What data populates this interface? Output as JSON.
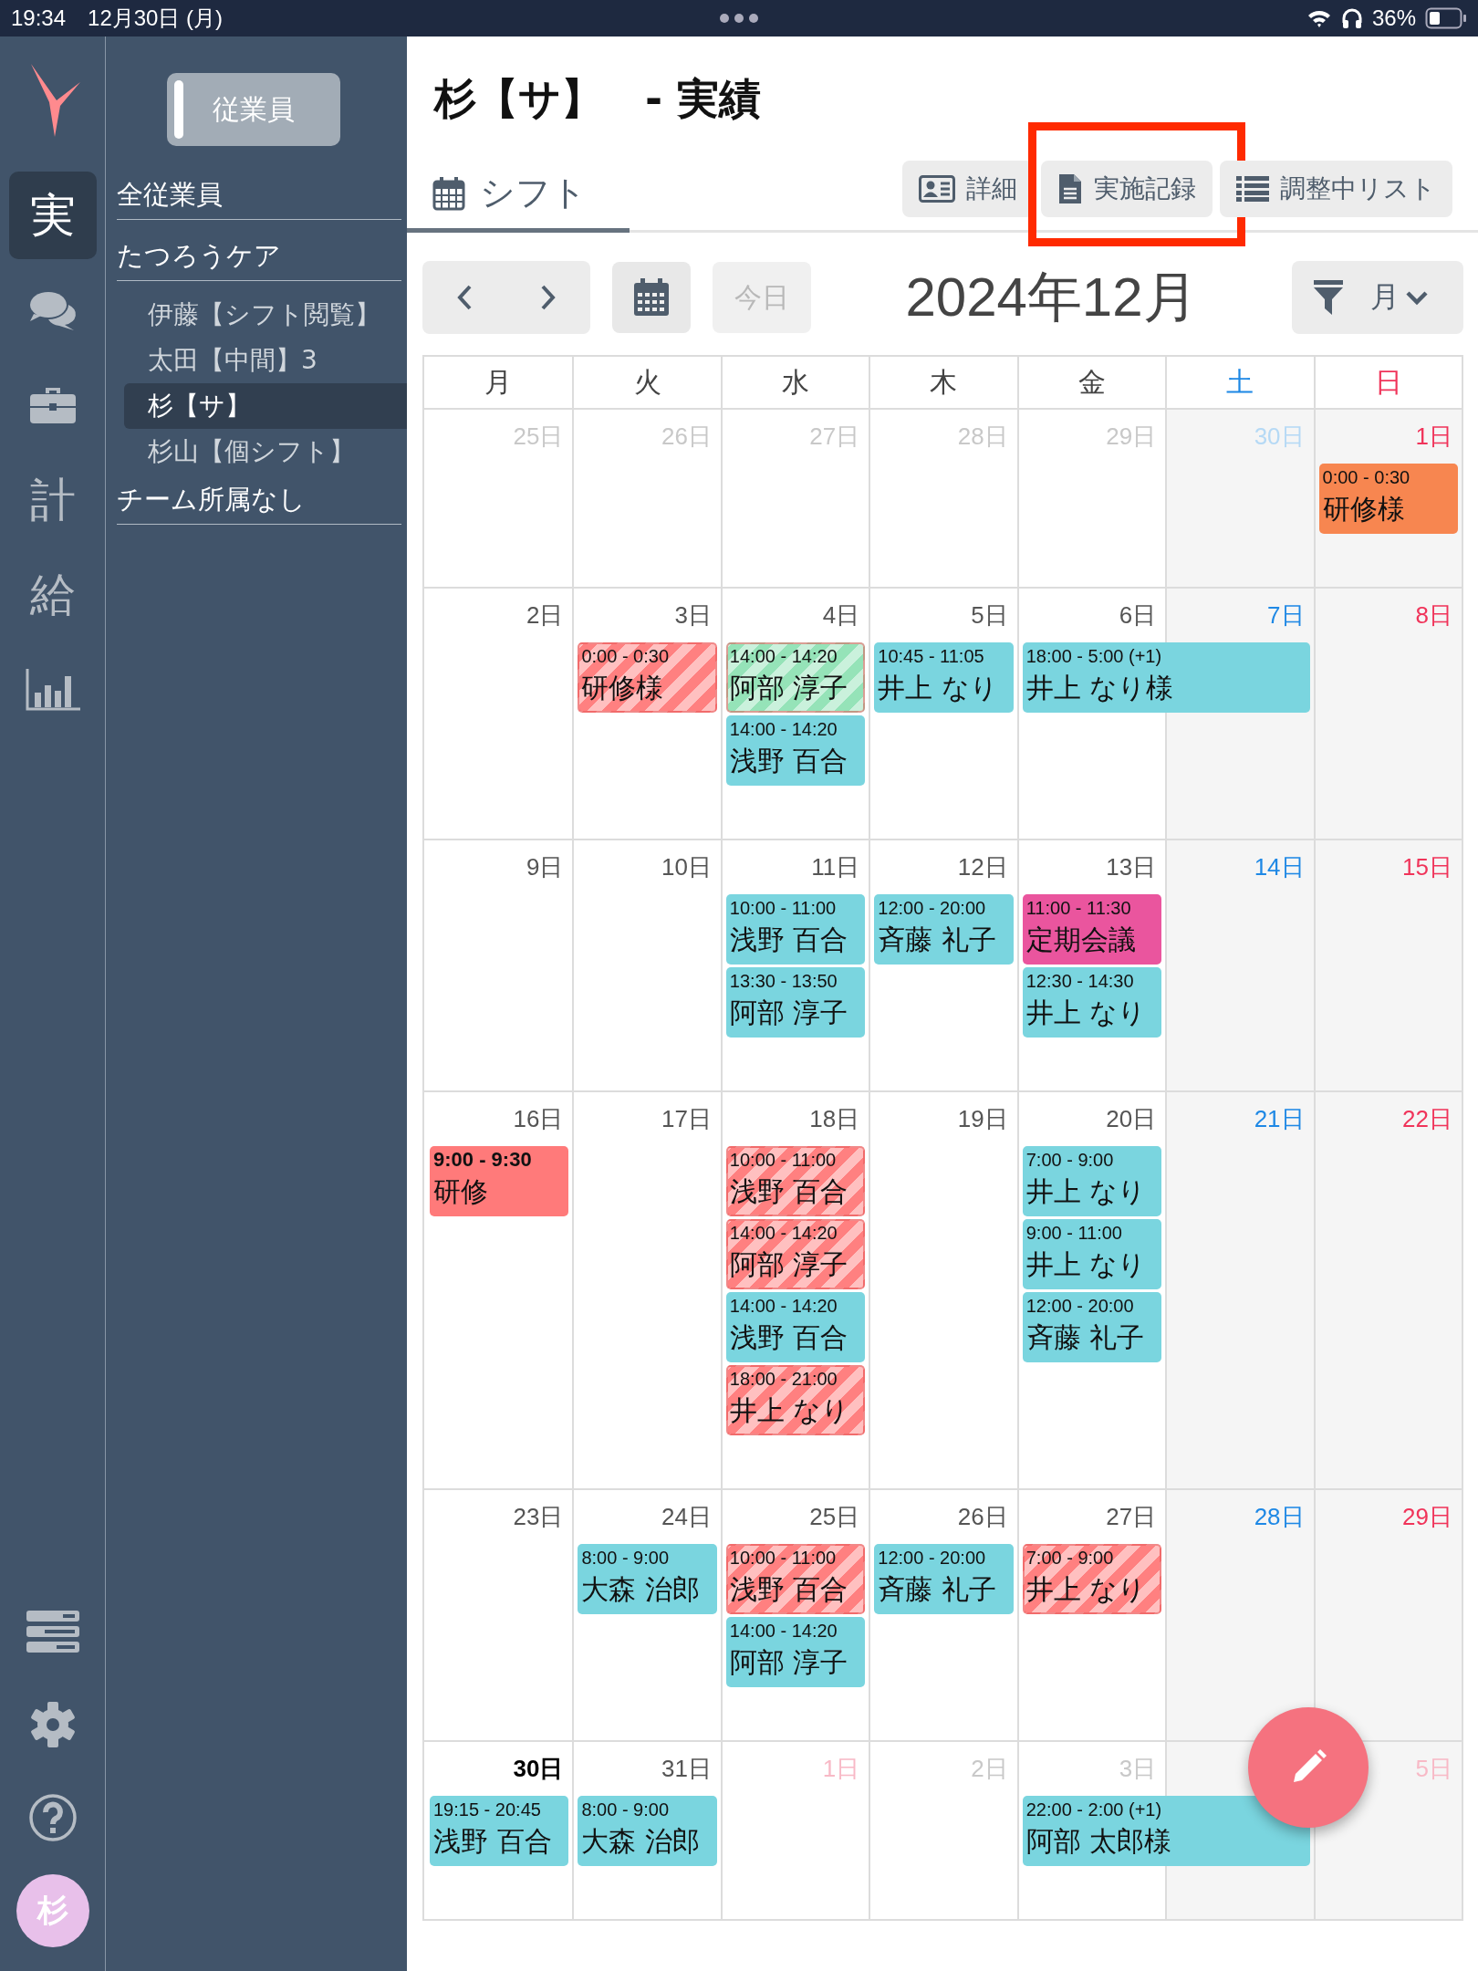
{
  "status_bar": {
    "time": "19:34",
    "date": "12月30日 (月)",
    "battery": "36%"
  },
  "rail": {
    "top": [
      {
        "kind": "text",
        "label": "実",
        "selected": true
      },
      {
        "kind": "chat",
        "selected": false
      },
      {
        "kind": "briefcase",
        "selected": false
      },
      {
        "kind": "text",
        "label": "計",
        "selected": false
      },
      {
        "kind": "text",
        "label": "給",
        "selected": false
      },
      {
        "kind": "chart",
        "selected": false
      }
    ],
    "bottom": [
      {
        "kind": "list"
      },
      {
        "kind": "settings"
      },
      {
        "kind": "help"
      },
      {
        "kind": "avatar",
        "label": "杉"
      }
    ]
  },
  "sidebar": {
    "toggle": "従業員",
    "groups": [
      {
        "title": "全従業員"
      },
      {
        "title": "たつろうケア",
        "items": [
          {
            "label": "伊藤【シフト閲覧】",
            "selected": false
          },
          {
            "label": "太田【中間】3",
            "selected": false
          },
          {
            "label": "杉【サ】",
            "selected": true
          },
          {
            "label": "杉山【個シフト】",
            "selected": false
          }
        ]
      },
      {
        "title": "チーム所属なし"
      }
    ]
  },
  "page_title": "杉【サ】　- 実績",
  "tabs": [
    {
      "label": "シフト",
      "selected": true
    }
  ],
  "actions": [
    {
      "kind": "card",
      "label": "詳細",
      "highlighted": false
    },
    {
      "kind": "doc",
      "label": "実施記録",
      "highlighted": true
    },
    {
      "kind": "list",
      "label": "調整中リスト",
      "highlighted": false
    }
  ],
  "toolbar": {
    "today": "今日",
    "today_disabled": true,
    "month": "2024年12月",
    "view": "月"
  },
  "weekdays": [
    "月",
    "火",
    "水",
    "木",
    "金",
    "土",
    "日"
  ],
  "weeks": [
    {
      "days": [
        {
          "label": "25日",
          "kind": "outside"
        },
        {
          "label": "26日",
          "kind": "outside"
        },
        {
          "label": "27日",
          "kind": "outside"
        },
        {
          "label": "28日",
          "kind": "outside"
        },
        {
          "label": "29日",
          "kind": "outside"
        },
        {
          "label": "30日",
          "kind": "outside"
        },
        {
          "label": "1日",
          "kind": "current",
          "events": [
            {
              "time": "0:00 - 0:30",
              "title": "研修様",
              "kind": "solid",
              "color": "#f78650"
            }
          ]
        }
      ]
    },
    {
      "days": [
        {
          "label": "2日",
          "kind": "current"
        },
        {
          "label": "3日",
          "kind": "current",
          "events": [
            {
              "time": "0:00 - 0:30",
              "title": "研修様",
              "kind": "striped",
              "color": "#ff8080"
            }
          ]
        },
        {
          "label": "4日",
          "kind": "current",
          "events": [
            {
              "time": "14:00 - 14:20",
              "title": "阿部 淳子",
              "kind": "striped",
              "color": "#95e3b8"
            },
            {
              "time": "14:00 - 14:20",
              "title": "浅野 百合",
              "kind": "solid",
              "color": "#7ad5df"
            }
          ]
        },
        {
          "label": "5日",
          "kind": "current",
          "events": [
            {
              "time": "10:45 - 11:05",
              "title": "井上 なり",
              "kind": "solid",
              "color": "#7ad5df"
            }
          ]
        },
        {
          "label": "6日",
          "kind": "current",
          "events": [
            {
              "time": "18:00 - 5:00 (+1)",
              "title": "井上 なり様",
              "kind": "overnight",
              "color": "#7ad5df"
            }
          ]
        },
        {
          "label": "7日",
          "kind": "current"
        },
        {
          "label": "8日",
          "kind": "current"
        }
      ]
    },
    {
      "days": [
        {
          "label": "9日",
          "kind": "current"
        },
        {
          "label": "10日",
          "kind": "current"
        },
        {
          "label": "11日",
          "kind": "current",
          "events": [
            {
              "time": "10:00 - 11:00",
              "title": "浅野 百合",
              "kind": "solid",
              "color": "#7ad5df"
            },
            {
              "time": "13:30 - 13:50",
              "title": "阿部 淳子",
              "kind": "solid",
              "color": "#7ad5df"
            }
          ]
        },
        {
          "label": "12日",
          "kind": "current",
          "events": [
            {
              "time": "12:00 - 20:00",
              "title": "斉藤 礼子",
              "kind": "solid",
              "color": "#7ad5df"
            }
          ]
        },
        {
          "label": "13日",
          "kind": "current",
          "events": [
            {
              "time": "11:00 - 11:30",
              "title": "定期会議",
              "kind": "solid",
              "color": "#ea559e"
            },
            {
              "time": "12:30 - 14:30",
              "title": "井上 なり",
              "kind": "solid",
              "color": "#7ad5df"
            }
          ]
        },
        {
          "label": "14日",
          "kind": "current"
        },
        {
          "label": "15日",
          "kind": "current"
        }
      ]
    },
    {
      "days": [
        {
          "label": "16日",
          "kind": "current",
          "events": [
            {
              "time": "9:00 - 9:30",
              "title": "研修",
              "kind": "bold",
              "color": "#ff7a7a"
            }
          ]
        },
        {
          "label": "17日",
          "kind": "current"
        },
        {
          "label": "18日",
          "kind": "current",
          "events": [
            {
              "time": "10:00 - 11:00",
              "title": "浅野 百合",
              "kind": "striped",
              "color": "#ff8080"
            },
            {
              "time": "14:00 - 14:20",
              "title": "阿部 淳子",
              "kind": "striped",
              "color": "#ff8080"
            },
            {
              "time": "14:00 - 14:20",
              "title": "浅野 百合",
              "kind": "solid",
              "color": "#7ad5df"
            },
            {
              "time": "18:00 - 21:00",
              "title": "井上 なり",
              "kind": "striped",
              "color": "#ff8080"
            }
          ]
        },
        {
          "label": "19日",
          "kind": "current"
        },
        {
          "label": "20日",
          "kind": "current",
          "events": [
            {
              "time": "7:00 - 9:00",
              "title": "井上 なり",
              "kind": "solid",
              "color": "#7ad5df"
            },
            {
              "time": "9:00 - 11:00",
              "title": "井上 なり",
              "kind": "solid",
              "color": "#7ad5df"
            },
            {
              "time": "12:00 - 20:00",
              "title": "斉藤 礼子",
              "kind": "solid",
              "color": "#7ad5df"
            }
          ]
        },
        {
          "label": "21日",
          "kind": "current"
        },
        {
          "label": "22日",
          "kind": "current"
        }
      ]
    },
    {
      "days": [
        {
          "label": "23日",
          "kind": "current"
        },
        {
          "label": "24日",
          "kind": "current",
          "events": [
            {
              "time": "8:00 - 9:00",
              "title": "大森 治郎",
              "kind": "solid",
              "color": "#7ad5df"
            }
          ]
        },
        {
          "label": "25日",
          "kind": "current",
          "events": [
            {
              "time": "10:00 - 11:00",
              "title": "浅野 百合",
              "kind": "striped",
              "color": "#ff8080"
            },
            {
              "time": "14:00 - 14:20",
              "title": "阿部 淳子",
              "kind": "solid",
              "color": "#7ad5df"
            }
          ]
        },
        {
          "label": "26日",
          "kind": "current",
          "events": [
            {
              "time": "12:00 - 20:00",
              "title": "斉藤 礼子",
              "kind": "solid",
              "color": "#7ad5df"
            }
          ]
        },
        {
          "label": "27日",
          "kind": "current",
          "events": [
            {
              "time": "7:00 - 9:00",
              "title": "井上 なり",
              "kind": "striped",
              "color": "#ff8080"
            }
          ]
        },
        {
          "label": "28日",
          "kind": "current"
        },
        {
          "label": "29日",
          "kind": "current"
        }
      ]
    },
    {
      "days": [
        {
          "label": "30日",
          "kind": "today",
          "events": [
            {
              "time": "19:15 - 20:45",
              "title": "浅野 百合",
              "kind": "solid",
              "color": "#7ad5df"
            }
          ]
        },
        {
          "label": "31日",
          "kind": "current",
          "events": [
            {
              "time": "8:00 - 9:00",
              "title": "大森 治郎",
              "kind": "solid",
              "color": "#7ad5df"
            }
          ]
        },
        {
          "label": "1日",
          "kind": "outside_holiday"
        },
        {
          "label": "2日",
          "kind": "outside"
        },
        {
          "label": "3日",
          "kind": "outside",
          "events": [
            {
              "time": "22:00 - 2:00 (+1)",
              "title": "阿部 太郎様",
              "kind": "overnight",
              "color": "#7ad5df"
            }
          ]
        },
        {
          "kind": "hidden"
        },
        {
          "label": "5日",
          "kind": "outside"
        }
      ]
    }
  ]
}
